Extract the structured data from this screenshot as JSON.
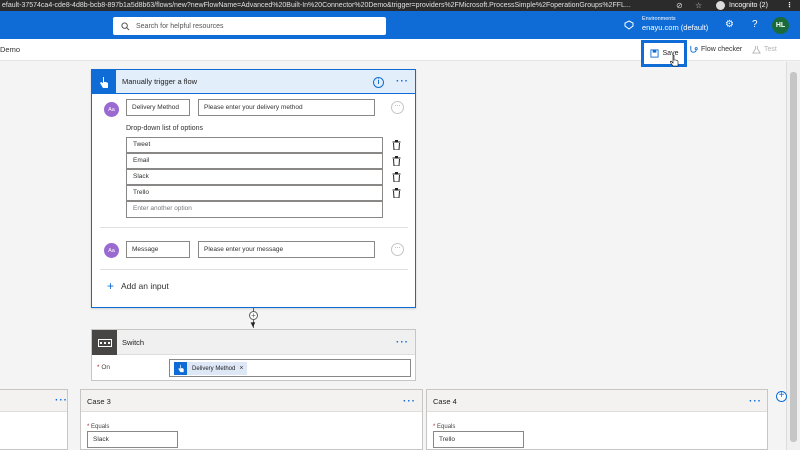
{
  "browser": {
    "url": "efault-37574ca4-cde8-4d8b-bcb8-897b1a5d8b63/flows/new?newFlowName=Advanced%20Built-In%20Connector%20Demo&trigger=providers%2FMicrosoft.ProcessSimple%2FoperationGroups%2FFL...",
    "incognito_label": "Incognito (2)"
  },
  "header": {
    "search_placeholder": "Search for helpful resources",
    "environment_label": "Environments",
    "environment_value": "enayu.com (default)",
    "avatar_initials": "HL",
    "brand_color": "#0f6cd6"
  },
  "command_bar": {
    "breadcrumb": "Demo",
    "save_label": "Save",
    "flow_checker_label": "Flow checker",
    "test_label": "Test"
  },
  "trigger": {
    "title": "Manually trigger a flow",
    "inputs": [
      {
        "name": "Delivery Method",
        "placeholder": "Please enter your delivery method"
      },
      {
        "name": "Message",
        "placeholder": "Please enter your message"
      }
    ],
    "dropdown_title": "Drop-down list of options",
    "options": [
      "Tweet",
      "Email",
      "Slack",
      "Trello"
    ],
    "option_placeholder": "Enter another option",
    "add_input_label": "Add an input"
  },
  "switch": {
    "title": "Switch",
    "on_label": "On",
    "token": "Delivery Method"
  },
  "cases": [
    {
      "title": "Case 3",
      "equals_label": "Equals",
      "value": "Slack"
    },
    {
      "title": "Case 4",
      "equals_label": "Equals",
      "value": "Trello"
    }
  ]
}
